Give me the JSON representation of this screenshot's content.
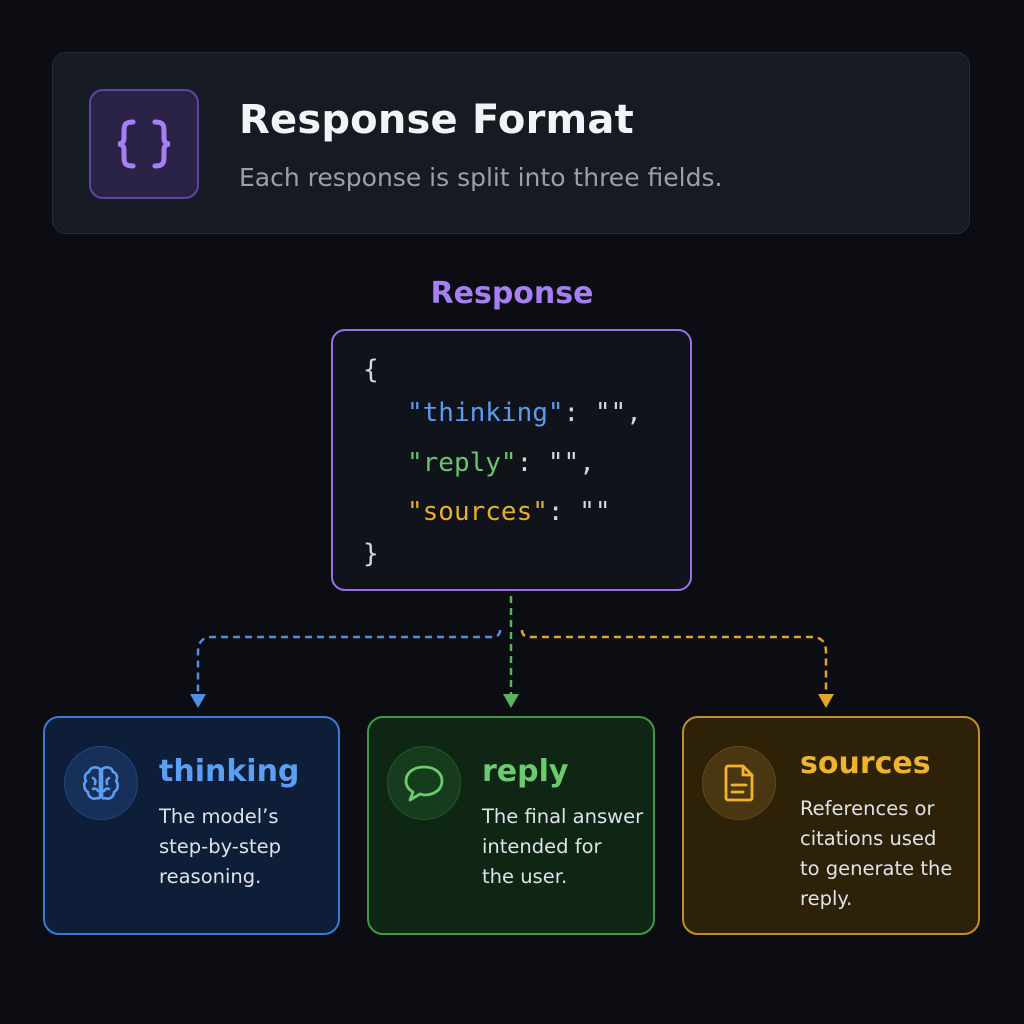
{
  "header": {
    "icon": "curly-braces-icon",
    "title": "Response Format",
    "subtitle": "Each response is split into three fields."
  },
  "diagram": {
    "label": "Response",
    "code": {
      "open_brace": "{",
      "close_brace": "}",
      "fields": [
        {
          "key": "\"thinking\"",
          "rest": ": \"\",",
          "color": "#5b9cf0"
        },
        {
          "key": "\"reply\"",
          "rest": ": \"\",",
          "color": "#67c56c"
        },
        {
          "key": "\"sources\"",
          "rest": ": \"\"",
          "color": "#e8ad2c"
        }
      ]
    },
    "cards": [
      {
        "icon": "brain-icon",
        "title": "thinking",
        "lines": [
          "The model’s",
          "step-by-step",
          "reasoning."
        ],
        "color": "#3d79d6"
      },
      {
        "icon": "chat-bubble-icon",
        "title": "reply",
        "lines": [
          "The final answer",
          "intended for",
          "the user."
        ],
        "color": "#3f9a47"
      },
      {
        "icon": "document-icon",
        "title": "sources",
        "lines": [
          "References or",
          "citations used",
          "to generate the",
          "reply."
        ],
        "color": "#c38e23"
      }
    ]
  },
  "colors": {
    "accent_purple": "#9a70ee",
    "blue": "#5b9cf0",
    "green": "#67c56c",
    "amber": "#e8ad2c",
    "background": "#0b0d12"
  }
}
